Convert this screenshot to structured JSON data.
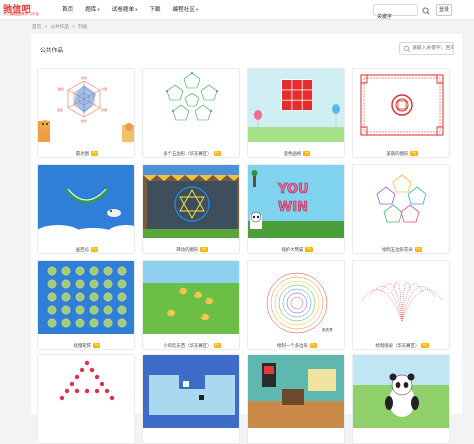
{
  "header": {
    "logo_title": "驰信吧",
    "logo_subtitle": "少儿编程题教学习平台",
    "nav": [
      {
        "label": "首页",
        "dropdown": false
      },
      {
        "label": "题库",
        "dropdown": true
      },
      {
        "label": "试卷题单",
        "dropdown": true
      },
      {
        "label": "下载",
        "dropdown": false
      },
      {
        "label": "编程社区",
        "dropdown": true
      }
    ],
    "search_value": "关键字",
    "login_label": "登录"
  },
  "breadcrumb": [
    "首页",
    ">",
    "公共作品",
    ">",
    "列表"
  ],
  "page_title": "公共作品",
  "search": {
    "placeholder": "请输入关键字，回车"
  },
  "badge_label": "Py",
  "works": [
    {
      "title": "雷达图",
      "thumb": "radar"
    },
    {
      "title": "多个五边形（华东赛区）",
      "thumb": "pentagons"
    },
    {
      "title": "变色画格",
      "thumb": "grid"
    },
    {
      "title": "美丽的图形",
      "thumb": "pattern"
    },
    {
      "title": "画西瓜",
      "thumb": "watermelon"
    },
    {
      "title": "转动的图形",
      "thumb": "spin"
    },
    {
      "title": "保护大熊猫",
      "thumb": "panda"
    },
    {
      "title": "绘制五边形花朵",
      "thumb": "flower"
    },
    {
      "title": "抚慢矩阵",
      "thumb": "matrix"
    },
    {
      "title": "小鸡吃东西（华东赛区）",
      "thumb": "chicks"
    },
    {
      "title": "绘制一个多边形",
      "thumb": "polygon",
      "watermark": "张先青"
    },
    {
      "title": "绘制喷泉（华东赛区）",
      "thumb": "fountain"
    },
    {
      "title": "",
      "thumb": "hearts"
    },
    {
      "title": "",
      "thumb": "maze"
    },
    {
      "title": "",
      "thumb": "room"
    },
    {
      "title": "",
      "thumb": "panda2"
    }
  ]
}
